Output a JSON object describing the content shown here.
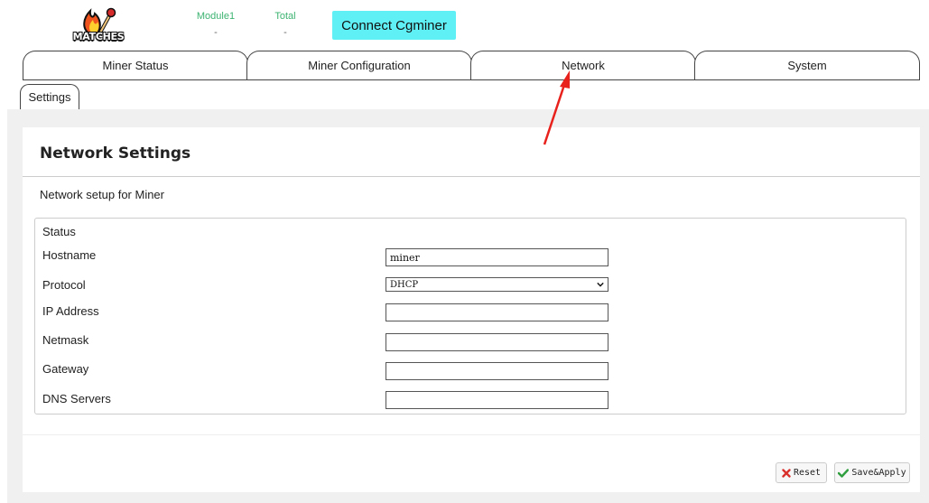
{
  "header": {
    "logo_text": "MATCHES",
    "stats": [
      {
        "label": "Module1",
        "value": "-"
      },
      {
        "label": "Total",
        "value": "-"
      }
    ],
    "connect_label": "Connect Cgminer"
  },
  "tabs": [
    {
      "label": "Miner Status"
    },
    {
      "label": "Miner Configuration"
    },
    {
      "label": "Network"
    },
    {
      "label": "System"
    }
  ],
  "active_tab": "Network",
  "subtabs": [
    {
      "label": "Settings"
    }
  ],
  "panel": {
    "title": "Network Settings",
    "description": "Network setup for Miner",
    "section_legend": "Status",
    "fields": {
      "hostname": {
        "label": "Hostname",
        "value": "miner"
      },
      "protocol": {
        "label": "Protocol",
        "value": "DHCP"
      },
      "ip_address": {
        "label": "IP Address",
        "value": ""
      },
      "netmask": {
        "label": "Netmask",
        "value": ""
      },
      "gateway": {
        "label": "Gateway",
        "value": ""
      },
      "dns_servers": {
        "label": "DNS Servers",
        "value": ""
      }
    },
    "buttons": {
      "reset": "Reset",
      "save_apply": "Save&Apply"
    }
  },
  "colors": {
    "connect_button": "#5ff0f5",
    "stat_label": "#3cb371",
    "annotation_arrow": "#e8211c",
    "reset_icon": "#d9302c",
    "save_icon": "#2e9e3e"
  },
  "icons": {
    "logo": "flame-matchstick-logo-icon",
    "reset": "x-mark-icon",
    "save": "check-mark-icon",
    "select": "chevron-down-icon"
  }
}
